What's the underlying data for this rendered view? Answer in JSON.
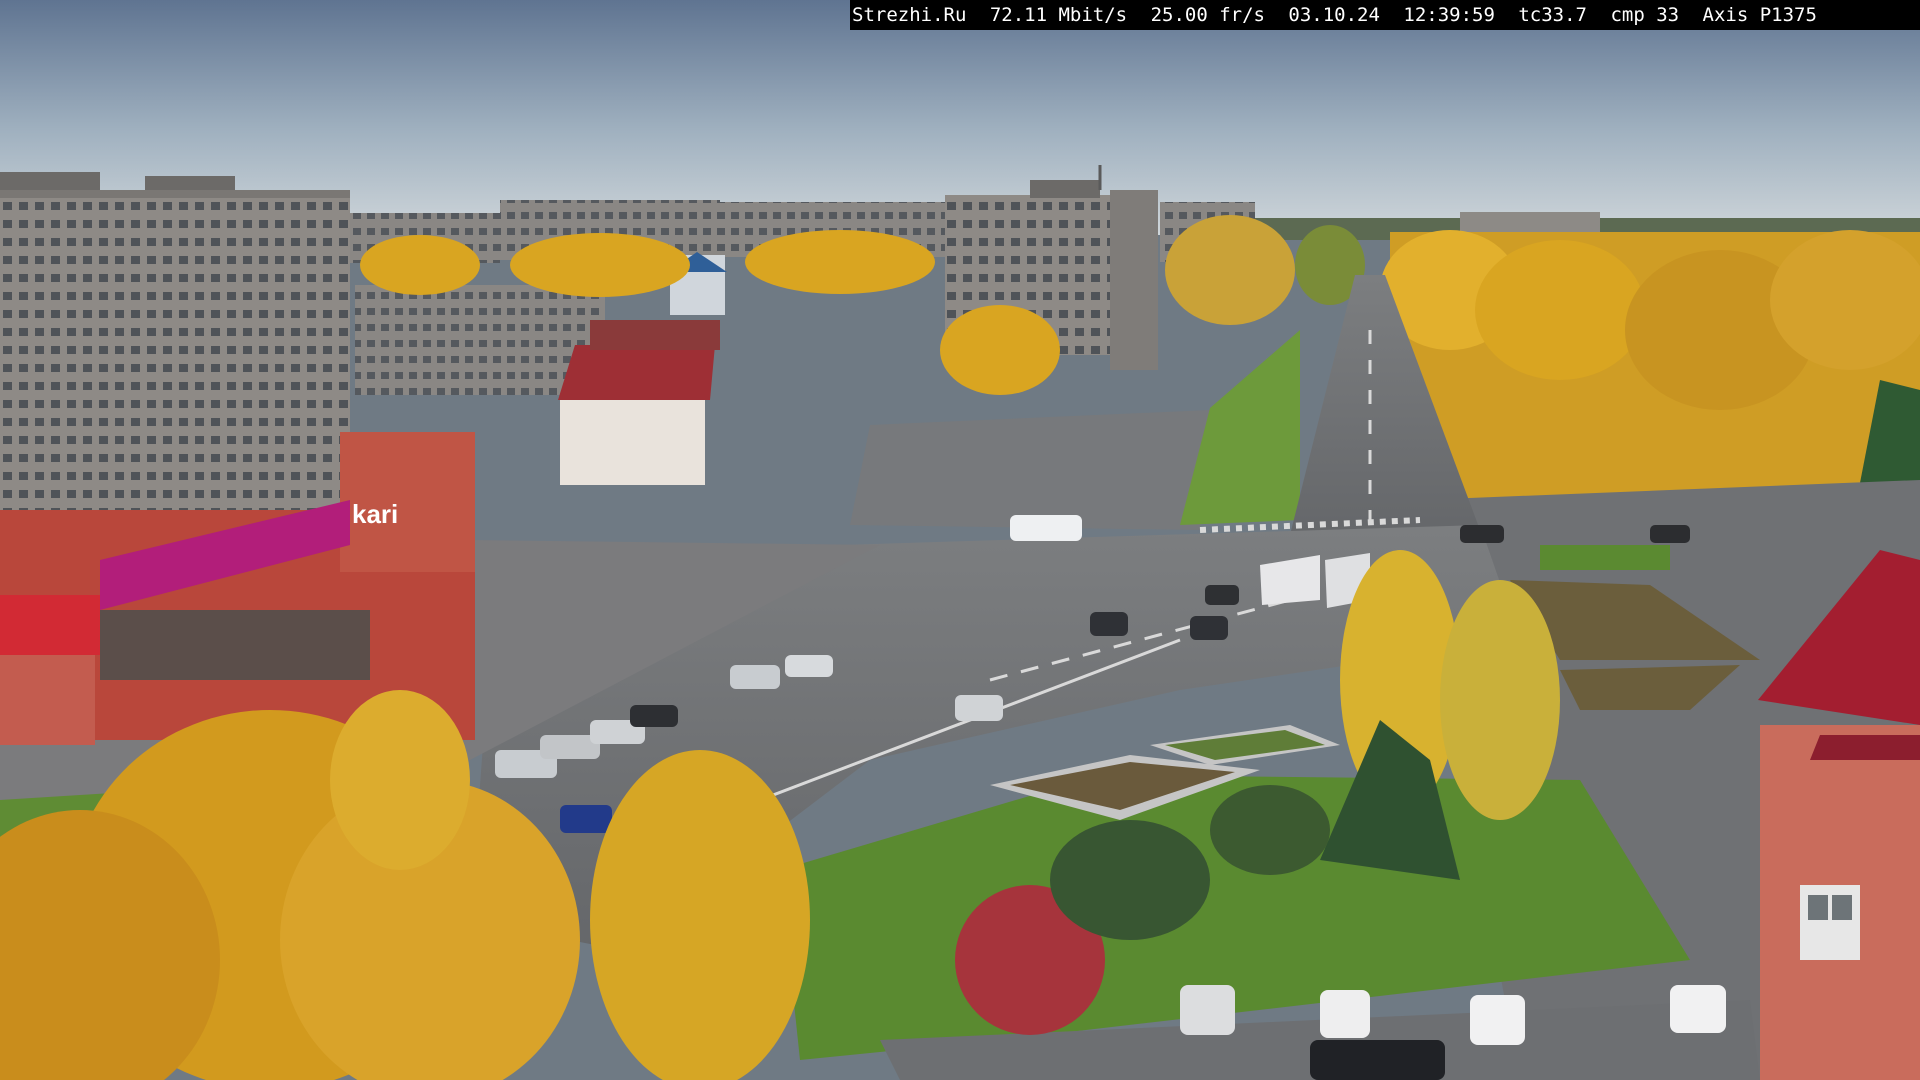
{
  "osd": {
    "site": "Strezhi.Ru",
    "bitrate": "72.11 Mbit/s",
    "framerate": "25.00 fr/s",
    "date": "03.10.24",
    "time": "12:39:59",
    "tc": "tc33.7",
    "cmp": "cmp 33",
    "camera": "Axis P1375"
  },
  "signs": {
    "store_brand": "kari"
  },
  "colors": {
    "sky_top": "#5f7491",
    "sky_bottom": "#c9d3d9",
    "foliage": "#d9a521",
    "road": "#6e7073",
    "lawn": "#5f8c34",
    "store_magenta": "#b21e7a",
    "brick_red": "#b9473b"
  }
}
